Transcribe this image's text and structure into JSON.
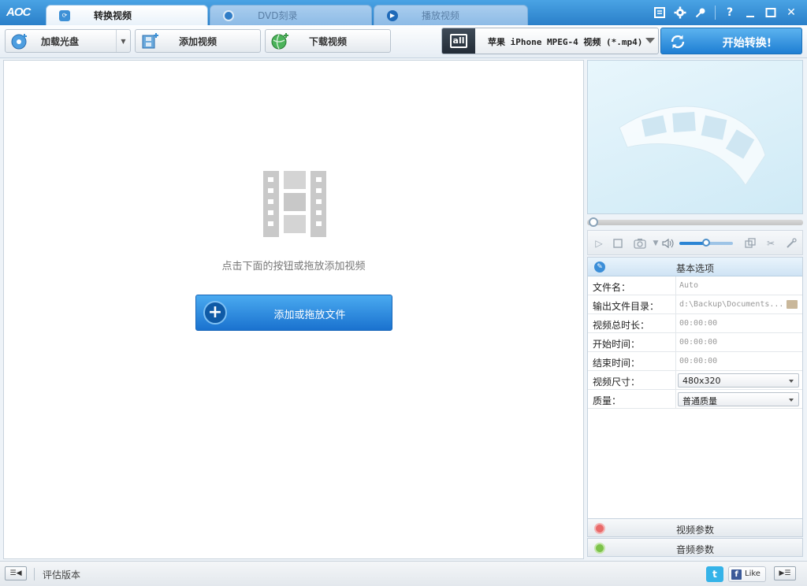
{
  "app": {
    "logo": "AOC",
    "tabs": [
      {
        "label": "转换视频",
        "icon": "convert-icon",
        "active": true
      },
      {
        "label": "DVD刻录",
        "icon": "disc-icon",
        "active": false
      },
      {
        "label": "播放视频",
        "icon": "play-icon",
        "active": false
      }
    ],
    "window_controls": [
      "log-icon",
      "gear-icon",
      "key-icon",
      "help-icon",
      "minimize-icon",
      "maximize-icon",
      "close-icon"
    ],
    "help_glyph": "?",
    "close_glyph": "✕"
  },
  "toolbar": {
    "load_disc_label": "加载光盘",
    "add_video_label": "添加视频",
    "download_label": "下载视频",
    "profile_badge": "all",
    "profile_text": "苹果 iPhone MPEG-4 视频 (*.mp4)",
    "start_label": "开始转换!"
  },
  "main": {
    "hint": "点击下面的按钮或拖放添加视频",
    "add_file_label": "添加或拖放文件",
    "add_file_glyph": "+"
  },
  "player": {
    "progress": 0,
    "volume": 0.5
  },
  "options": {
    "header": "基本选项",
    "rows": [
      {
        "label": "文件名：",
        "value": "Auto"
      },
      {
        "label": "输出文件目录：",
        "value": "d:\\Backup\\Documents..."
      },
      {
        "label": "视频总时长：",
        "value": "00:00:00"
      },
      {
        "label": "开始时间：",
        "value": "00:00:00"
      },
      {
        "label": "结束时间：",
        "value": "00:00:00"
      }
    ],
    "size_label": "视频尺寸：",
    "size_value": "480x320",
    "quality_label": "质量：",
    "quality_value": "普通质量",
    "video_params": "视频参数",
    "audio_params": "音频参数"
  },
  "statusbar": {
    "text": "评估版本",
    "twitter_glyph": "t",
    "fb_glyph": "f",
    "fb_like": "Like"
  },
  "colors": {
    "accent": "#2a7fc9",
    "start_button": "#1e7ed3"
  }
}
